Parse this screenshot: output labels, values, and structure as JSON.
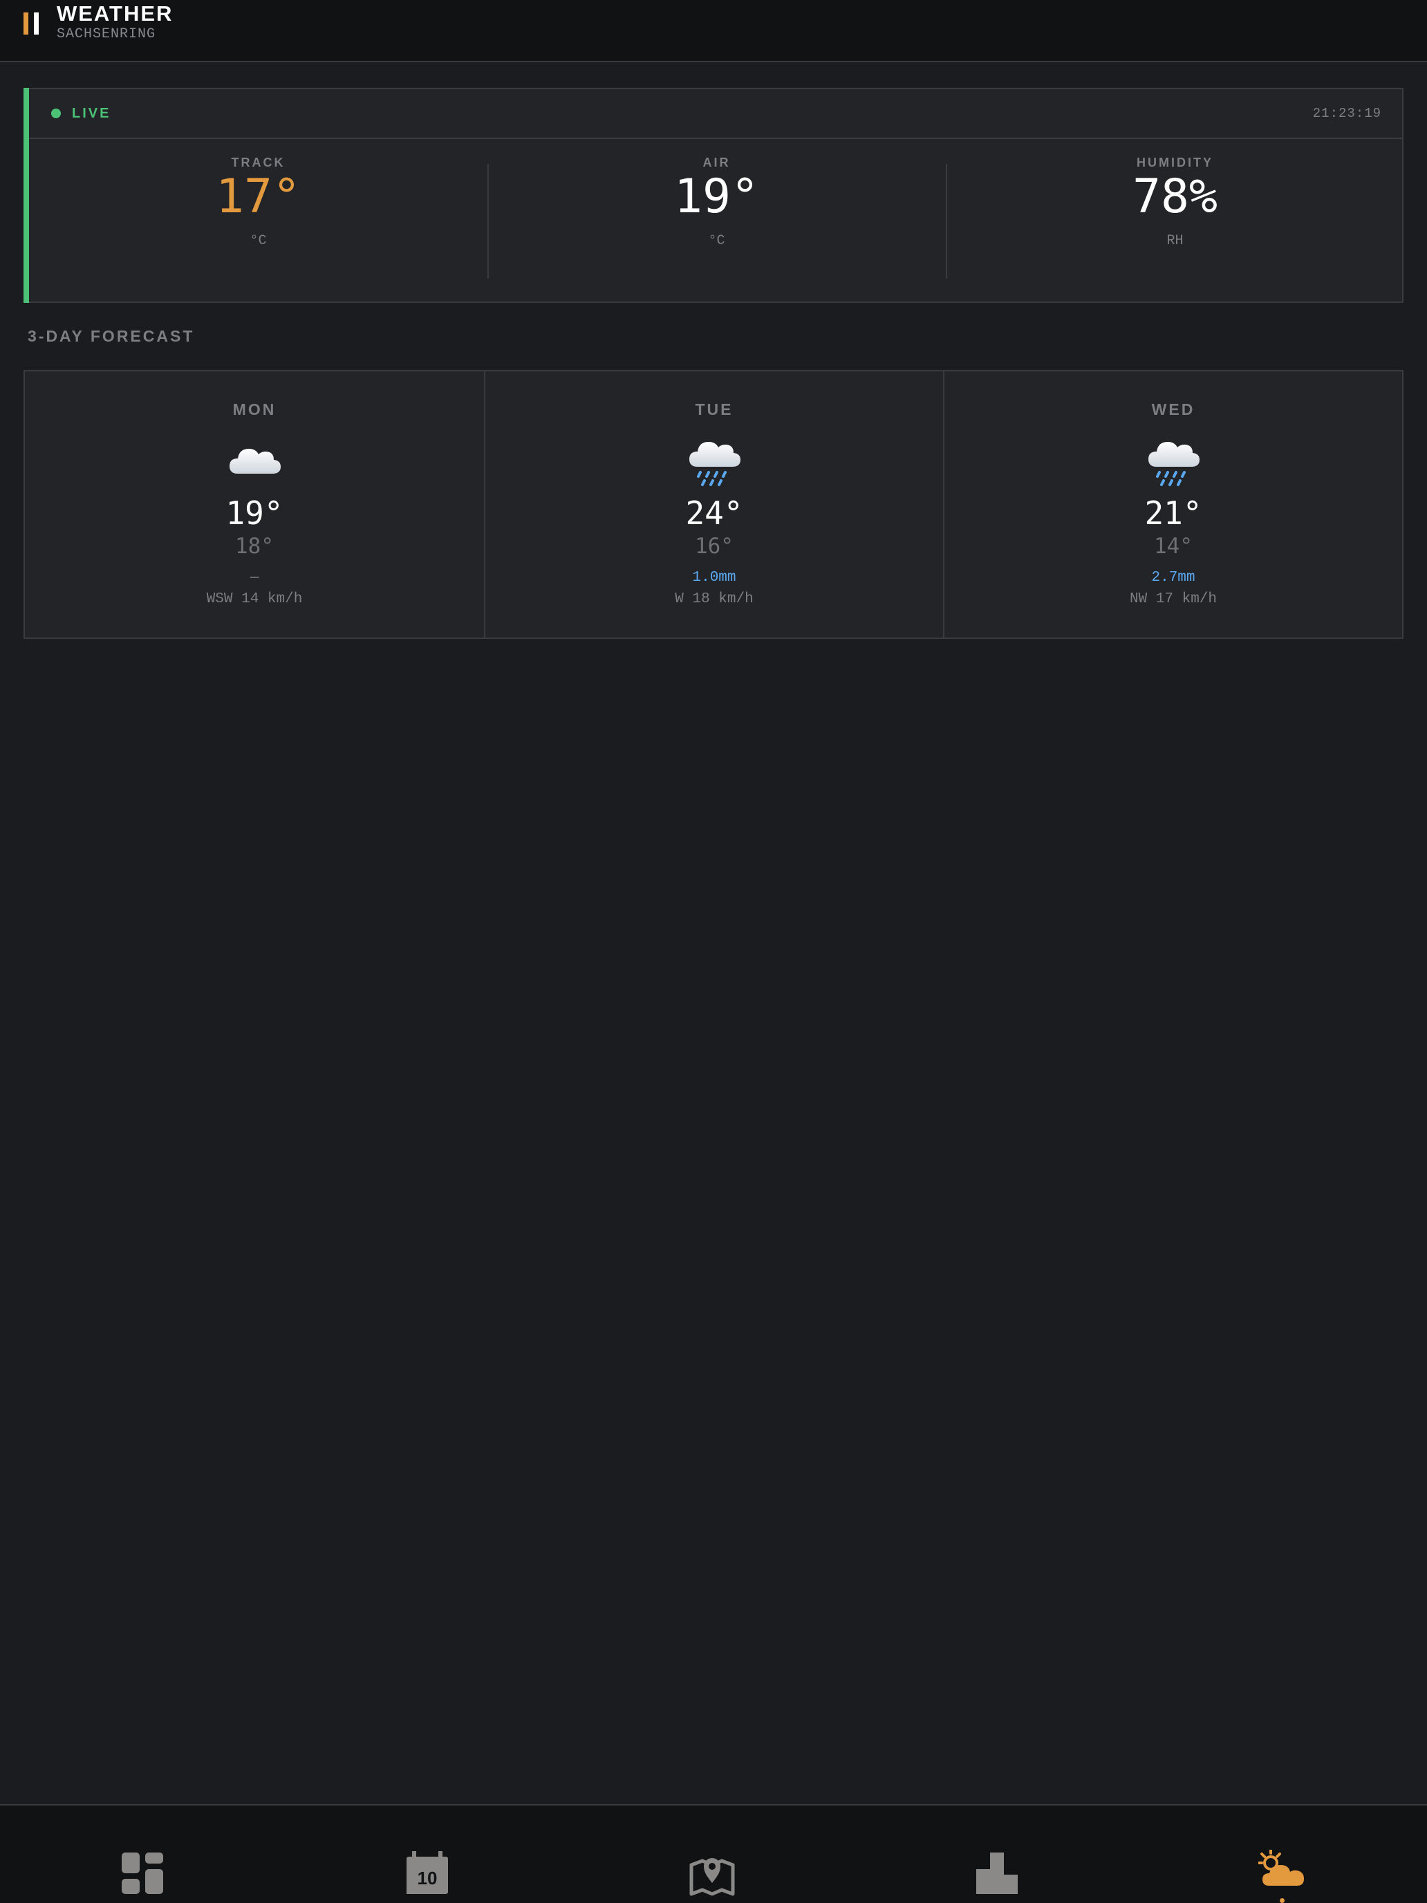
{
  "header": {
    "title": "WEATHER",
    "subtitle": "SACHSENRING"
  },
  "live": {
    "status": "LIVE",
    "time": "21:23:19",
    "metrics": [
      {
        "label": "TRACK",
        "value": "17°",
        "unit": "°C"
      },
      {
        "label": "AIR",
        "value": "19°",
        "unit": "°C"
      },
      {
        "label": "HUMIDITY",
        "value": "78%",
        "unit": "RH"
      }
    ]
  },
  "forecast": {
    "title": "3-DAY FORECAST",
    "days": [
      {
        "day": "MON",
        "icon": "cloud-icon",
        "high": "19°",
        "low": "18°",
        "precip": "—",
        "wind": "WSW 14 km/h"
      },
      {
        "day": "TUE",
        "icon": "rain-cloud-icon",
        "high": "24°",
        "low": "16°",
        "precip": "1.0mm",
        "wind": "W 18 km/h"
      },
      {
        "day": "WED",
        "icon": "rain-cloud-icon",
        "high": "21°",
        "low": "14°",
        "precip": "2.7mm",
        "wind": "NW 17 km/h"
      }
    ]
  },
  "nav": {
    "items": [
      {
        "name": "dashboard",
        "icon": "dashboard-icon",
        "active": false
      },
      {
        "name": "calendar",
        "icon": "calendar-icon",
        "active": false,
        "badge": "10"
      },
      {
        "name": "map",
        "icon": "map-pin-icon",
        "active": false
      },
      {
        "name": "standings",
        "icon": "podium-icon",
        "active": false
      },
      {
        "name": "weather",
        "icon": "sun-cloud-icon",
        "active": true
      }
    ]
  },
  "colors": {
    "background": "#1b1c20",
    "accent": "#e39a3e",
    "live": "#4cc277",
    "rain": "#5aa8f0"
  }
}
